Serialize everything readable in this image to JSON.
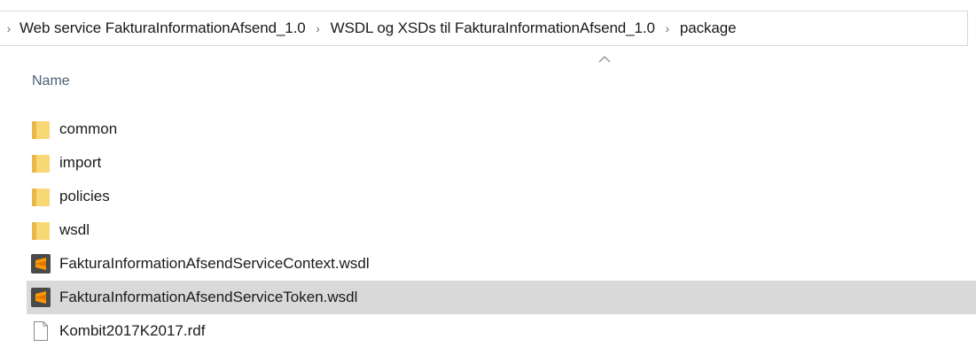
{
  "breadcrumb": {
    "items": [
      "Web service FakturaInformationAfsend_1.0",
      "WSDL og XSDs til FakturaInformationAfsend_1.0",
      "package"
    ]
  },
  "columns": {
    "name_label": "Name",
    "sort_indicator": "chevron-up-icon"
  },
  "files": [
    {
      "name": "common",
      "type": "folder",
      "icon": "folder-icon",
      "selected": false
    },
    {
      "name": "import",
      "type": "folder",
      "icon": "folder-icon",
      "selected": false
    },
    {
      "name": "policies",
      "type": "folder",
      "icon": "folder-icon",
      "selected": false
    },
    {
      "name": "wsdl",
      "type": "folder",
      "icon": "folder-icon",
      "selected": false
    },
    {
      "name": "FakturaInformationAfsendServiceContext.wsdl",
      "type": "wsdl",
      "icon": "sublime-text-icon",
      "selected": false
    },
    {
      "name": "FakturaInformationAfsendServiceToken.wsdl",
      "type": "wsdl",
      "icon": "sublime-text-icon",
      "selected": true
    },
    {
      "name": "Kombit2017K2017.rdf",
      "type": "rdf",
      "icon": "document-icon",
      "selected": false
    }
  ],
  "colors": {
    "folder": "#f8d775",
    "folder_dark": "#e8b94a",
    "sublime_bg": "#4a4a4a",
    "sublime_accent": "#ff9800",
    "selection": "#d9d9d9",
    "header_text": "#4c607a"
  }
}
